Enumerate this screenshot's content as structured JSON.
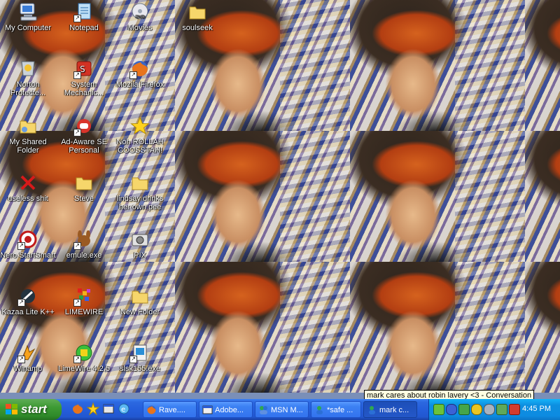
{
  "desktop": {
    "icons": [
      {
        "label": "My Computer",
        "icon": "my-computer-icon"
      },
      {
        "label": "Notepad",
        "icon": "notepad-icon"
      },
      {
        "label": "Movies",
        "icon": "movies-icon"
      },
      {
        "label": "soulseek",
        "icon": "folder-icon"
      },
      {
        "label": "Norton Protecte...",
        "icon": "norton-icon"
      },
      {
        "label": "System Mechanic...",
        "icon": "system-mechanic-icon"
      },
      {
        "label": "Mozila Firefox",
        "icon": "firefox-icon"
      },
      {
        "label": "My Shared Folder",
        "icon": "shared-folder-icon"
      },
      {
        "label": "Ad-Aware SE Personal",
        "icon": "ad-aware-icon"
      },
      {
        "label": "Noh ROLLAH COOSSTAH!",
        "icon": "star-icon"
      },
      {
        "label": "useless shit",
        "icon": "x-icon"
      },
      {
        "label": "Steve",
        "icon": "folder-icon"
      },
      {
        "label": "lindsay drinks her own pee",
        "icon": "folder-icon"
      },
      {
        "label": "Nero StartSmart",
        "icon": "nero-icon"
      },
      {
        "label": "emule.exe",
        "icon": "emule-icon"
      },
      {
        "label": "PIX",
        "icon": "camera-icon"
      },
      {
        "label": "Kazaa Lite K++",
        "icon": "kazaa-icon"
      },
      {
        "label": "LIMEWIRE",
        "icon": "limewire-icon"
      },
      {
        "label": "New Folder",
        "icon": "folder-icon"
      },
      {
        "label": "Winamp",
        "icon": "winamp-icon"
      },
      {
        "label": "LimeWire 4.2.5",
        "icon": "limewire-green-icon"
      },
      {
        "label": "slsk155.exe",
        "icon": "soulseek-exe-icon"
      }
    ]
  },
  "taskbar": {
    "start_label": "start",
    "quick_launch": [
      "firefox-icon",
      "star-icon",
      "window-icon",
      "ie-icon"
    ],
    "buttons": [
      {
        "label": "Rave....",
        "icon": "firefox-icon"
      },
      {
        "label": "Adobe...",
        "icon": "window-icon"
      },
      {
        "label": "MSN M...",
        "icon": "msn-icon"
      },
      {
        "label": "*safe ...",
        "icon": "chat-icon"
      },
      {
        "label": "mark c...",
        "icon": "chat-icon",
        "active": true
      }
    ],
    "tray_icons": [
      "green-icon",
      "blue-icon",
      "people-icon",
      "yellow-icon",
      "gray-icon",
      "network-icon",
      "shield-icon",
      "red-icon"
    ],
    "clock": "4:45 PM"
  },
  "tooltip": "mark cares about robin lavery <3 - Conversation",
  "colors": {
    "taskbar": "#245edb",
    "start": "#3d9a33",
    "tray": "#0d8fe0"
  }
}
